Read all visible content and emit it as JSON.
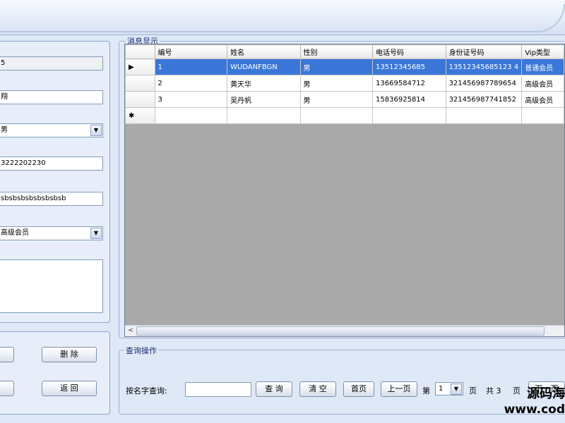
{
  "form": {
    "field1": "5",
    "field2": "翔",
    "field3": "男",
    "field4": "3222202230",
    "field5": "sbsbsbsbsbsbsbsb",
    "field6": "高级会员",
    "memo": ""
  },
  "buttons": {
    "delete": "删 除",
    "back": "返 回"
  },
  "grid": {
    "group_title": "消息显示",
    "columns": [
      "编号",
      "姓名",
      "性别",
      "电话号码",
      "身份证号码",
      "Vip类型"
    ],
    "rows": [
      {
        "marker": "▶",
        "id": "1",
        "name": "WUDANFBGN",
        "gender": "男",
        "phone": "13512345685",
        "idcard": "13512345685123 4",
        "vip": "普通会员"
      },
      {
        "marker": "",
        "id": "2",
        "name": "黄天华",
        "gender": "男",
        "phone": "13669584712",
        "idcard": "321456987789654",
        "vip": "高级会员"
      },
      {
        "marker": "",
        "id": "3",
        "name": "吴丹帆",
        "gender": "男",
        "phone": "15836925814",
        "idcard": "321456987741852",
        "vip": "高级会员"
      },
      {
        "marker": "✱",
        "id": "",
        "name": "",
        "gender": "",
        "phone": "",
        "idcard": "",
        "vip": ""
      }
    ]
  },
  "query": {
    "group_title": "查询操作",
    "search_label": "按名字查询:",
    "search_value": "",
    "query_btn": "查 询",
    "clear_btn": "清 空",
    "first_btn": "首页",
    "prev_btn": "上一页",
    "page_prefix": "第",
    "page_value": "1",
    "page_suffix": "页",
    "total_label": "共 3",
    "total_suffix": "页",
    "next_btn": "下一页"
  },
  "watermark": {
    "line1": "源码海",
    "line2": "www.cod"
  }
}
